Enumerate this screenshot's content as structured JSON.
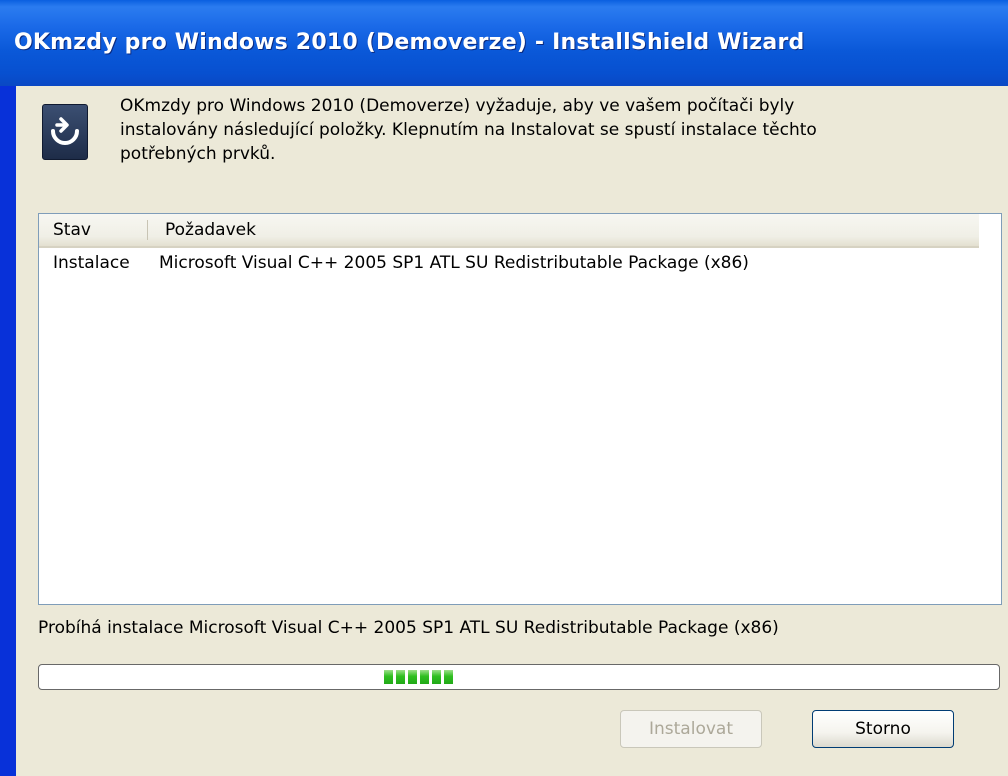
{
  "window": {
    "title": "OKmzdy pro Windows 2010 (Demoverze) - InstallShield Wizard"
  },
  "dialog": {
    "icon": "installer-icon",
    "message": "OKmzdy pro Windows 2010 (Demoverze) vyžaduje, aby ve vašem počítači byly\ninstalovány následující položky. Klepnutím na Instalovat se spustí instalace těchto\npotřebných prvků."
  },
  "list": {
    "columns": [
      "Stav",
      "Požadavek"
    ],
    "rows": [
      {
        "status": "Instalace",
        "requirement": "Microsoft Visual C++ 2005 SP1 ATL SU Redistributable Package (x86)"
      }
    ]
  },
  "status": {
    "text": "Probíhá instalace Microsoft Visual C++ 2005 SP1 ATL SU Redistributable Package (x86)"
  },
  "progress": {
    "mode": "marquee",
    "accent": "#2fbf20"
  },
  "buttons": {
    "install_label": "Instalovat",
    "cancel_label": "Storno"
  }
}
